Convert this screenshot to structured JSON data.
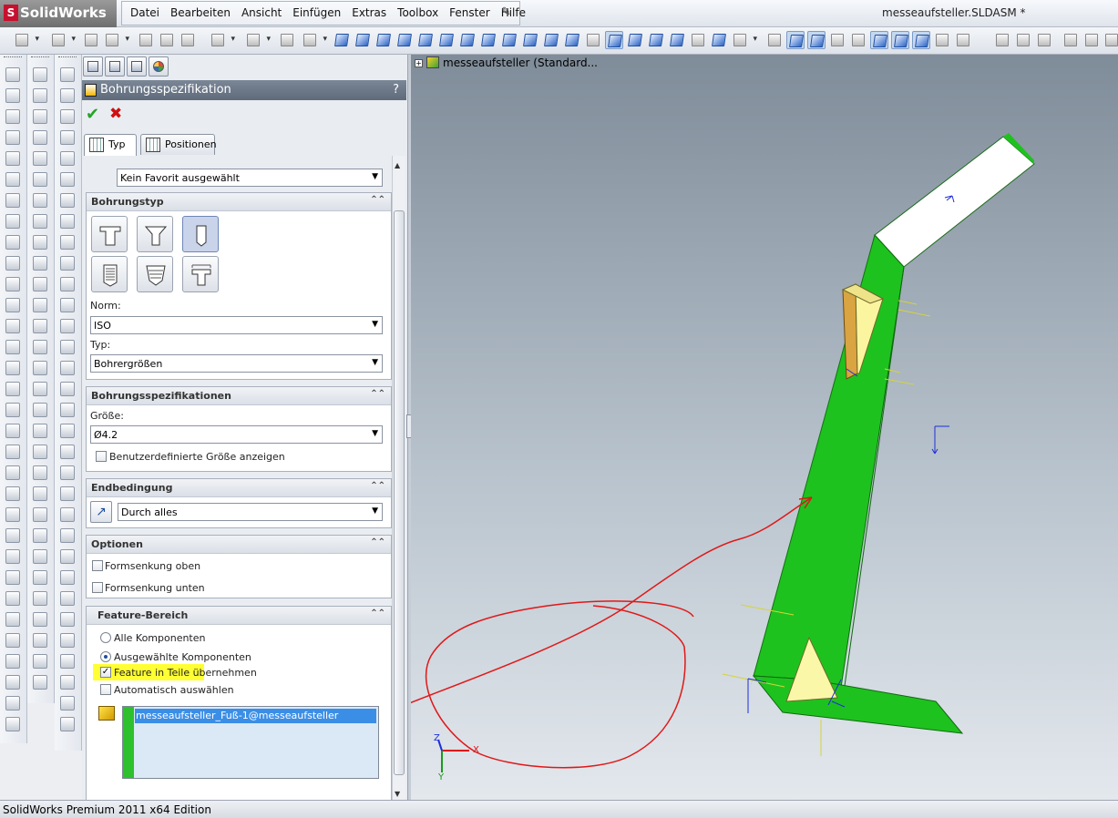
{
  "app": {
    "name": "SolidWorks",
    "logo_mark": "S",
    "document_title": "messeaufsteller.SLDASM *"
  },
  "menu": [
    "Datei",
    "Bearbeiten",
    "Ansicht",
    "Einfügen",
    "Extras",
    "Toolbox",
    "Fenster",
    "Hilfe"
  ],
  "property_manager": {
    "title": "Bohrungsspezifikation",
    "help": "?",
    "ok": "✔",
    "cancel": "✖",
    "tabs": {
      "type": "Typ",
      "positions": "Positionen"
    },
    "favorite": "Kein Favorit ausgewählt",
    "hole_type": {
      "header": "Bohrungstyp",
      "norm_label": "Norm:",
      "norm_value": "ISO",
      "type_label": "Typ:",
      "type_value": "Bohrergrößen"
    },
    "hole_specs": {
      "header": "Bohrungsspezifikationen",
      "size_label": "Größe:",
      "size_value": "Ø4.2",
      "custom_size_label": "Benutzerdefinierte Größe anzeigen"
    },
    "end_condition": {
      "header": "Endbedingung",
      "value": "Durch alles"
    },
    "options": {
      "header": "Optionen",
      "top_countersink": "Formsenkung oben",
      "bottom_countersink": "Formsenkung unten"
    },
    "feature_scope": {
      "header": "Feature-Bereich",
      "all_components": "Alle Komponenten",
      "selected_components": "Ausgewählte Komponenten",
      "propagate_to_parts": "Feature in Teile übernehmen",
      "auto_select": "Automatisch auswählen",
      "selected_item": "messeaufsteller_Fuß-1@messeaufsteller"
    }
  },
  "tree": {
    "root": "messeaufsteller  (Standard..."
  },
  "triad": {
    "x": "X",
    "y": "Y",
    "z": "Z"
  },
  "status": "SolidWorks Premium 2011 x64 Edition",
  "colors": {
    "part_green": "#1ec21e",
    "annotation_red": "#e01818",
    "highlight_yellow": "#ffff33",
    "selection_blue": "#3b8ee6"
  }
}
